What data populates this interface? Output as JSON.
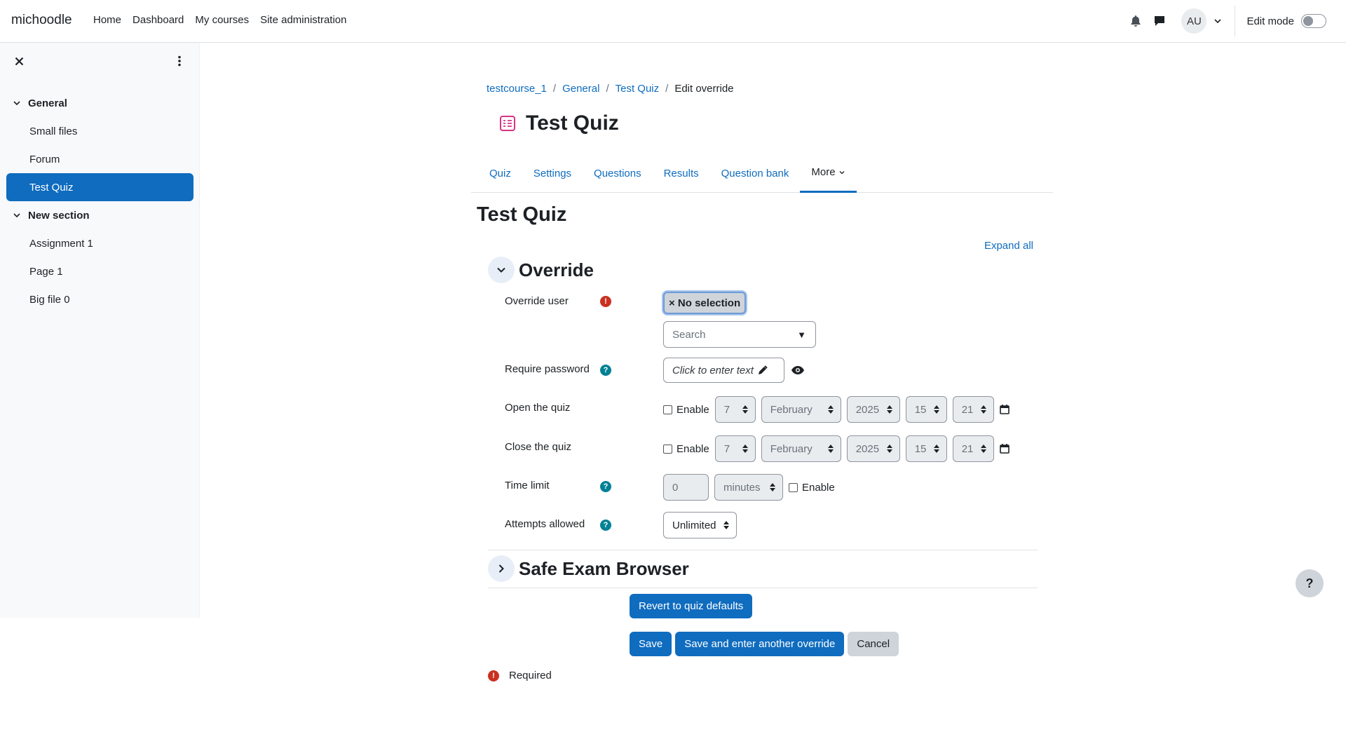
{
  "navbar": {
    "brand": "michoodle",
    "links": [
      "Home",
      "Dashboard",
      "My courses",
      "Site administration"
    ],
    "avatar_initials": "AU",
    "edit_mode_label": "Edit mode"
  },
  "drawer": {
    "sections": [
      {
        "title": "General",
        "items": [
          "Small files",
          "Forum",
          "Test Quiz"
        ]
      },
      {
        "title": "New section",
        "items": [
          "Assignment 1",
          "Page 1",
          "Big file 0"
        ]
      }
    ],
    "active_item": "Test Quiz"
  },
  "breadcrumb": [
    "testcourse_1",
    "General",
    "Test Quiz",
    "Edit override"
  ],
  "page_title": "Test Quiz",
  "tabs": [
    "Quiz",
    "Settings",
    "Questions",
    "Results",
    "Question bank",
    "More"
  ],
  "active_tab": "More",
  "main_heading": "Test Quiz",
  "expand_all": "Expand all",
  "override_section": {
    "title": "Override",
    "fields": {
      "user": {
        "label": "Override user",
        "chip": "× No selection",
        "search_placeholder": "Search"
      },
      "password": {
        "label": "Require password",
        "placeholder": "Click to enter text"
      },
      "open": {
        "label": "Open the quiz",
        "enable": "Enable",
        "day": "7",
        "month": "February",
        "year": "2025",
        "hour": "15",
        "minute": "21"
      },
      "close": {
        "label": "Close the quiz",
        "enable": "Enable",
        "day": "7",
        "month": "February",
        "year": "2025",
        "hour": "15",
        "minute": "21"
      },
      "time_limit": {
        "label": "Time limit",
        "value": "0",
        "unit": "minutes",
        "enable": "Enable"
      },
      "attempts": {
        "label": "Attempts allowed",
        "value": "Unlimited"
      }
    }
  },
  "seb_section": {
    "title": "Safe Exam Browser"
  },
  "buttons": {
    "revert": "Revert to quiz defaults",
    "save": "Save",
    "save_another": "Save and enter another override",
    "cancel": "Cancel"
  },
  "required_note": "Required",
  "help_button": "?",
  "colors": {
    "primary": "#0f6cbf",
    "required": "#ca3120",
    "help": "#008196",
    "activity_icon": "#d63384"
  }
}
